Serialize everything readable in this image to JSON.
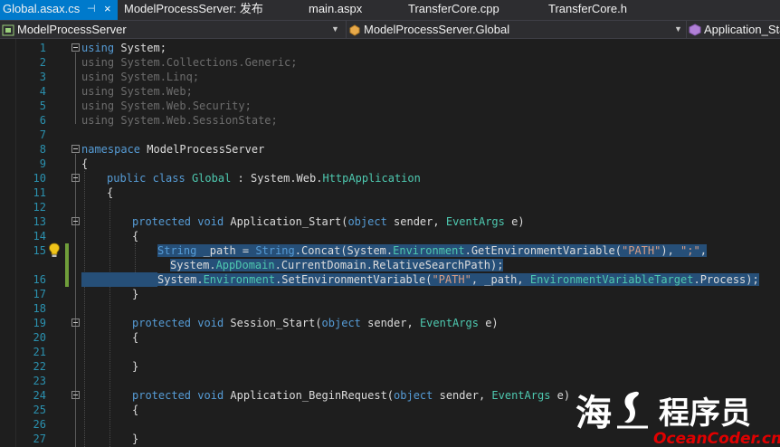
{
  "tabs": [
    {
      "label": "Global.asax.cs",
      "active": true
    },
    {
      "label": "ModelProcessServer: 发布"
    },
    {
      "label": "main.aspx"
    },
    {
      "label": "TransferCore.cpp"
    },
    {
      "label": "TransferCore.h"
    }
  ],
  "tab_pin_glyph": "⊣",
  "tab_close_glyph": "×",
  "nav": {
    "project": "ModelProcessServer",
    "class": "ModelProcessServer.Global",
    "member": "Application_Sta"
  },
  "line_numbers": [
    "1",
    "2",
    "3",
    "4",
    "5",
    "6",
    "7",
    "8",
    "9",
    "10",
    "11",
    "12",
    "13",
    "14",
    "15",
    "",
    "16",
    "17",
    "18",
    "19",
    "20",
    "21",
    "22",
    "23",
    "24",
    "25",
    "26",
    "27"
  ],
  "code": {
    "l1": [
      "using",
      " System;"
    ],
    "l2": [
      "using",
      " System.Collections.Generic;"
    ],
    "l3": [
      "using",
      " System.Linq;"
    ],
    "l4": [
      "using",
      " System.Web;"
    ],
    "l5": [
      "using",
      " System.Web.Security;"
    ],
    "l6": [
      "using",
      " System.Web.SessionState;"
    ],
    "l8": [
      "namespace",
      " ModelProcessServer"
    ],
    "l9": "{",
    "l10": [
      "public",
      " ",
      "class",
      " ",
      "Global",
      " : System.Web.",
      "HttpApplication"
    ],
    "l11": "{",
    "l13": [
      "protected",
      " ",
      "void",
      " Application_Start(",
      "object",
      " sender, ",
      "EventArgs",
      " e)"
    ],
    "l14": "{",
    "l15a": [
      "String",
      " _path = ",
      "String",
      ".Concat(System.",
      "Environment",
      ".GetEnvironmentVariable(",
      "\"PATH\"",
      "), ",
      "\";\"",
      ","
    ],
    "l15b": [
      "System.",
      "AppDomain",
      ".CurrentDomain.RelativeSearchPath);"
    ],
    "l16": [
      "System.",
      "Environment",
      ".SetEnvironmentVariable(",
      "\"PATH\"",
      ", _path, ",
      "EnvironmentVariableTarget",
      ".Process);"
    ],
    "l17": "}",
    "l19": [
      "protected",
      " ",
      "void",
      " Session_Start(",
      "object",
      " sender, ",
      "EventArgs",
      " e)"
    ],
    "l20": "{",
    "l22": "}",
    "l24": [
      "protected",
      " ",
      "void",
      " Application_BeginRequest(",
      "object",
      " sender, ",
      "EventArgs",
      " e)"
    ],
    "l25": "{",
    "l27": "}"
  },
  "watermark": {
    "chars": "海",
    "cn": "程序员",
    "en": "OceanCoder.cn"
  },
  "colors": {
    "accent": "#007acc",
    "keyword": "#569cd6",
    "type": "#4ec9b0",
    "string": "#d69d85",
    "line_number": "#2b91af",
    "selection": "#264f78",
    "watermark_red": "#e00000"
  }
}
